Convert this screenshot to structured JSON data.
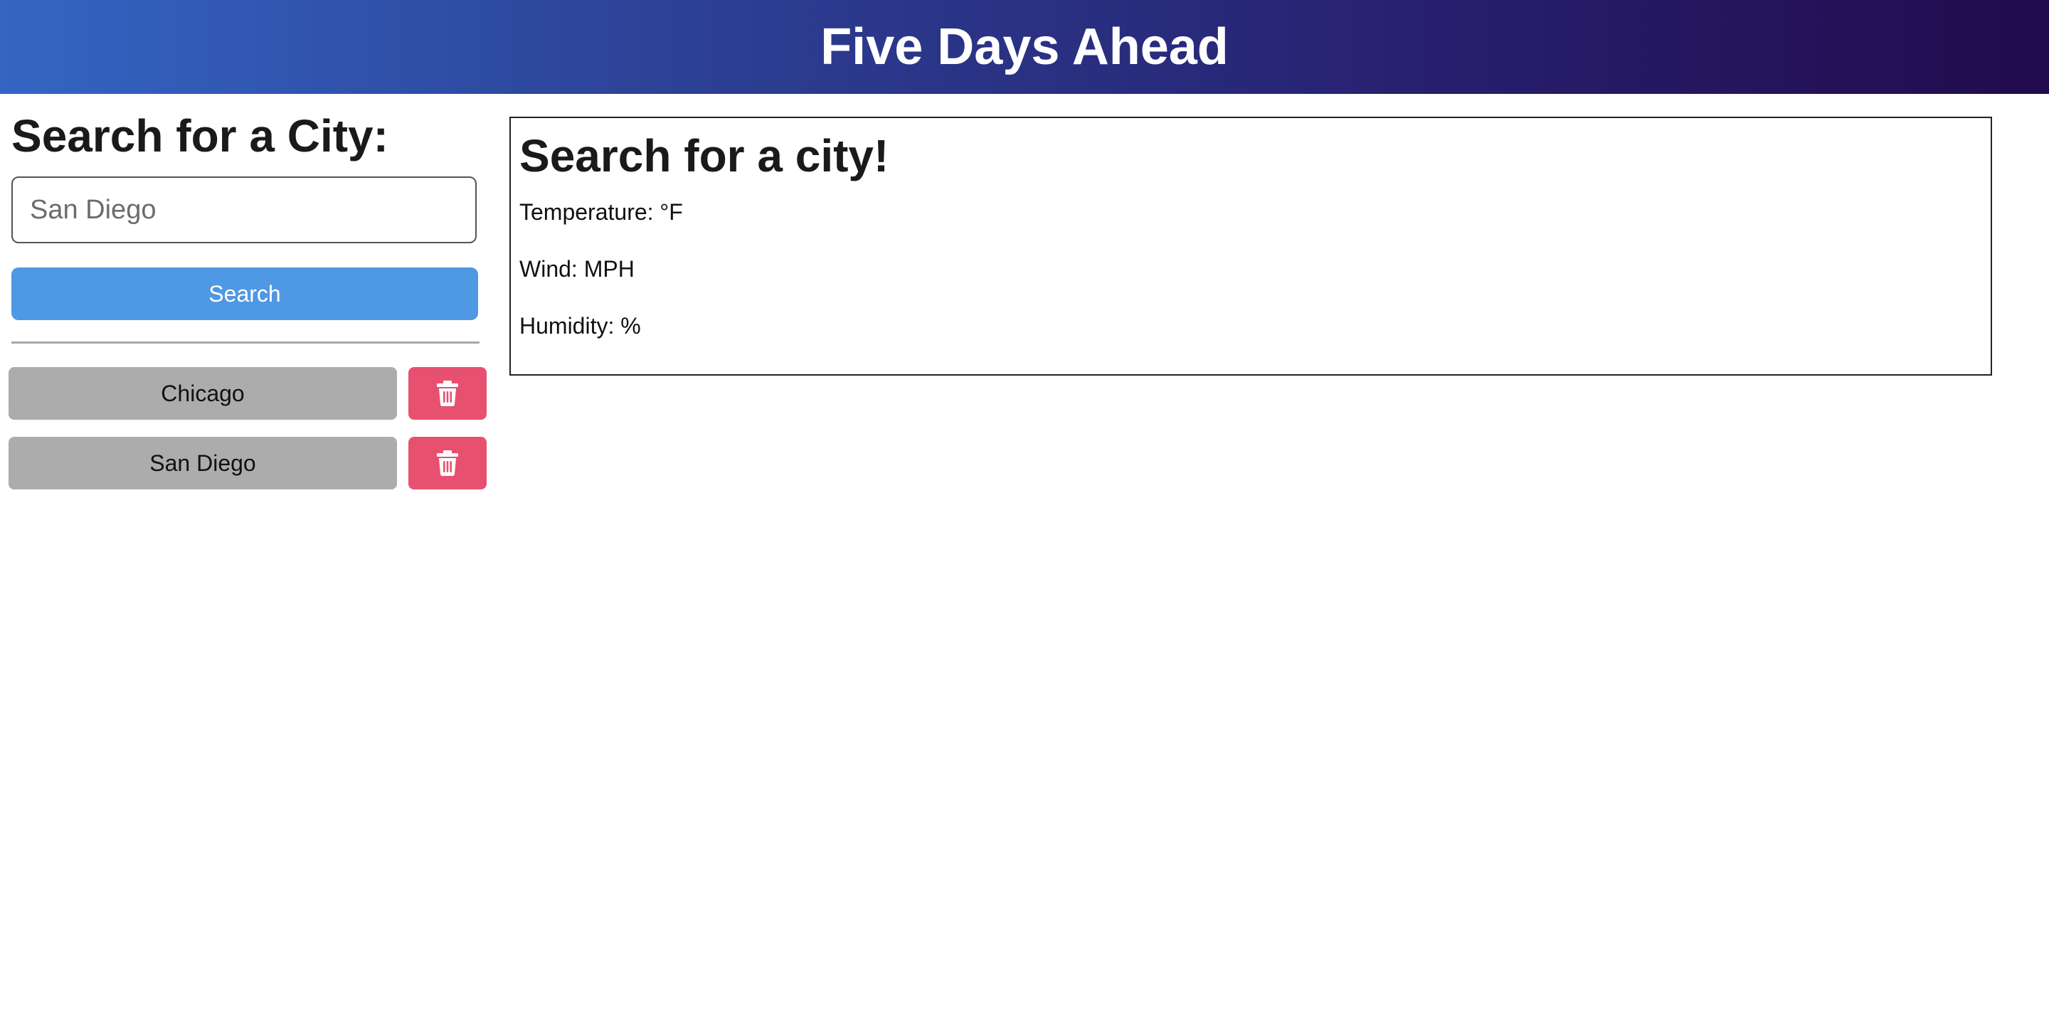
{
  "header": {
    "title": "Five Days Ahead"
  },
  "sidebar": {
    "title": "Search for a City:",
    "search": {
      "value": "",
      "placeholder": "San Diego",
      "button_label": "Search"
    },
    "history": [
      {
        "city": "Chicago",
        "delete_icon": "trash-icon"
      },
      {
        "city": "San Diego",
        "delete_icon": "trash-icon"
      }
    ]
  },
  "current": {
    "heading": "Search for a city!",
    "temperature": "Temperature: °F",
    "wind": "Wind: MPH",
    "humidity": "Humidity: %"
  },
  "colors": {
    "header_gradient_start": "#3465c3",
    "header_gradient_end": "#220b4d",
    "search_button": "#4f98e3",
    "history_button": "#acacac",
    "delete_button": "#e85070"
  }
}
